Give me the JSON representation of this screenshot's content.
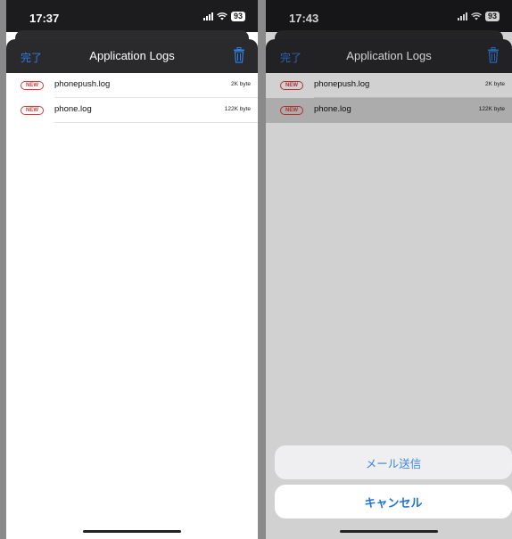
{
  "left": {
    "status": {
      "time": "17:37",
      "battery": "93"
    },
    "nav": {
      "done_label": "完了",
      "title": "Application Logs"
    },
    "files": [
      {
        "badge": "NEW",
        "name": "phonepush.log",
        "size": "2K byte"
      },
      {
        "badge": "NEW",
        "name": "phone.log",
        "size": "122K byte"
      }
    ]
  },
  "right": {
    "status": {
      "time": "17:43",
      "battery": "93"
    },
    "nav": {
      "done_label": "完了",
      "title": "Application Logs"
    },
    "files": [
      {
        "badge": "NEW",
        "name": "phonepush.log",
        "size": "2K byte"
      },
      {
        "badge": "NEW",
        "name": "phone.log",
        "size": "122K byte"
      }
    ],
    "action_sheet": {
      "send_mail_label": "メール送信",
      "cancel_label": "キャンセル"
    }
  },
  "colors": {
    "accent": "#2f7ee0",
    "badge": "#d93a3a",
    "nav_bg": "#2a2a2c"
  }
}
